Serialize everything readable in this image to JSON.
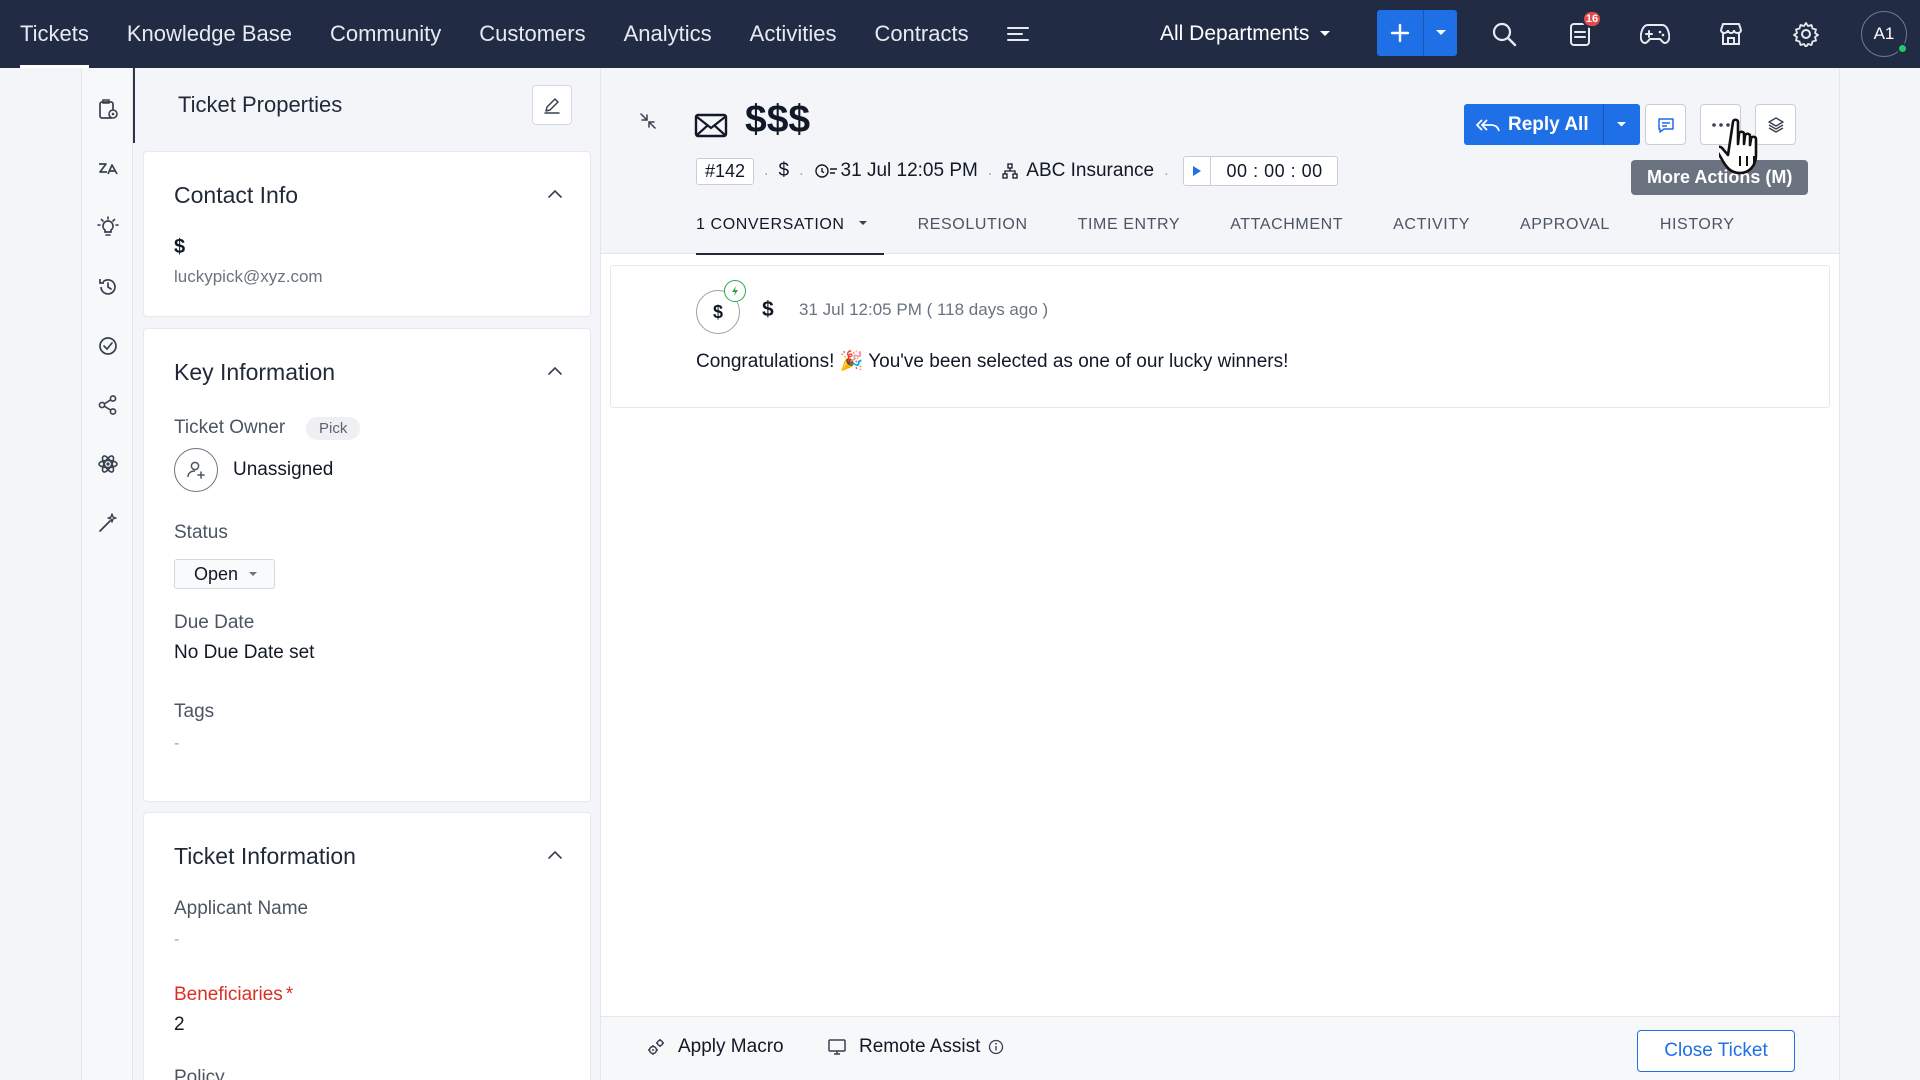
{
  "nav": {
    "tabs": [
      "Tickets",
      "Knowledge Base",
      "Community",
      "Customers",
      "Analytics",
      "Activities",
      "Contracts"
    ],
    "active_tab": "Tickets",
    "department": "All Departments",
    "notification_count": "16",
    "avatar_initials": "A1"
  },
  "props": {
    "title": "Ticket Properties",
    "contact": {
      "title": "Contact Info",
      "name": "$",
      "email": "luckypick@xyz.com"
    },
    "key_info": {
      "title": "Key Information",
      "owner_label": "Ticket Owner",
      "pick_label": "Pick",
      "owner_value": "Unassigned",
      "status_label": "Status",
      "status_value": "Open",
      "due_label": "Due Date",
      "due_value": "No Due Date set",
      "tags_label": "Tags",
      "tags_value": "-"
    },
    "ticket_info": {
      "title": "Ticket Information",
      "applicant_label": "Applicant Name",
      "applicant_value": "-",
      "beneficiaries_label": "Beneficiaries",
      "required_mark": "*",
      "beneficiaries_value": "2",
      "policy_label": "Policy"
    }
  },
  "ticket": {
    "subject": "$$$",
    "number": "#142",
    "contact": "$",
    "created": "31 Jul 12:05 PM",
    "account": "ABC Insurance",
    "timer": "00 : 00 : 00",
    "reply_all_label": "Reply All",
    "tooltip": "More Actions (M)",
    "tabs": [
      "1 CONVERSATION",
      "RESOLUTION",
      "TIME ENTRY",
      "ATTACHMENT",
      "ACTIVITY",
      "APPROVAL",
      "HISTORY"
    ]
  },
  "conversation": {
    "avatar": "$",
    "sender": "$",
    "time": "31 Jul 12:05 PM ( 118 days ago )",
    "body": "Congratulations! 🎉 You've been selected as one of our lucky winners!"
  },
  "footer": {
    "apply_macro": "Apply Macro",
    "remote_assist": "Remote Assist",
    "close_ticket": "Close Ticket"
  },
  "colors": {
    "nav_bg": "#212c44",
    "primary": "#1f6fe6",
    "required": "#d93025",
    "badge": "#e5484d"
  }
}
